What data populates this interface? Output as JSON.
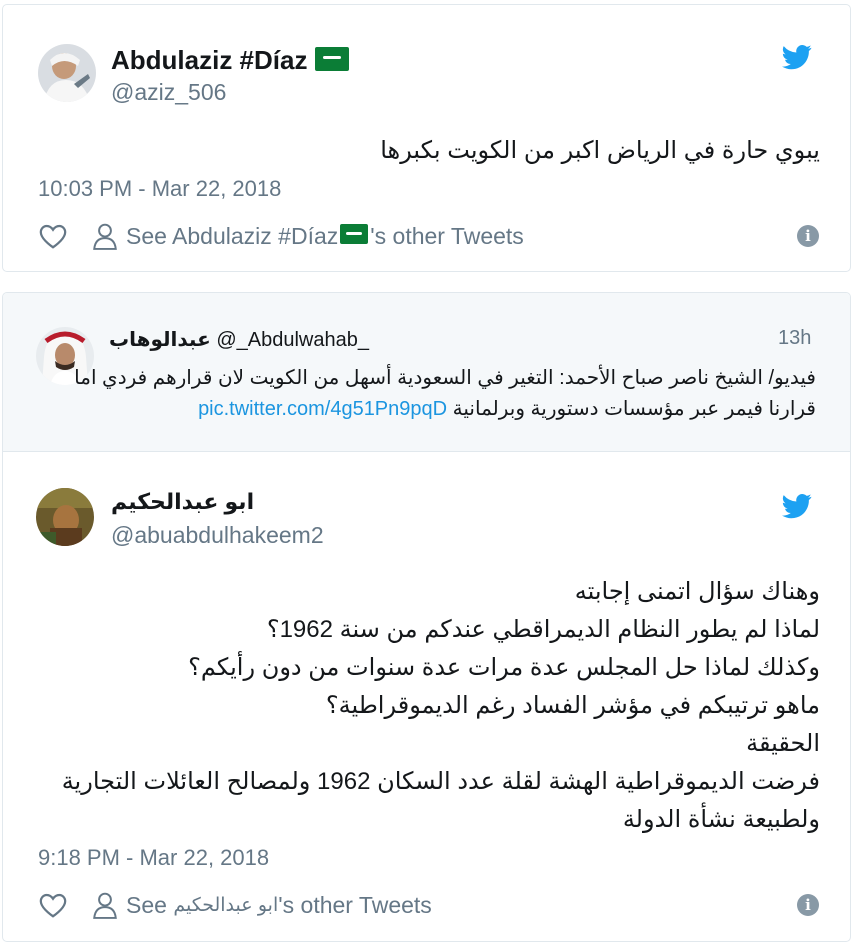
{
  "tweet1": {
    "display_name": "Abdulaziz #Díaz",
    "handle": "@aziz_506",
    "text": "يبوي حارة في الرياض اكبر من الكويت بكبرها",
    "timestamp": "10:03 PM - Mar 22, 2018",
    "see_prefix": "See Abdulaziz #Díaz",
    "see_suffix": "'s other Tweets",
    "info_label": "i"
  },
  "quoted": {
    "display_name": "عبدالوهاب",
    "handle": "@_Abdulwahab_",
    "time": "13h",
    "line1": "فيديو/ الشيخ ناصر صباح الأحمد: التغير في السعودية أسهل من الكويت لان قرارهم فردي اما",
    "line2_text": "قرارنا فيمر عبر مؤسسات دستورية وبرلمانية",
    "line2_link": "pic.twitter.com/4g51Pn9pqD"
  },
  "tweet2": {
    "display_name": "ابو عبدالحكيم",
    "handle": "@abuabdulhakeem2",
    "lines": [
      "وهناك سؤال اتمنى إجابته",
      "لماذا لم يطور النظام الديمراقطي عندكم من سنة 1962؟",
      "وكذلك لماذا حل المجلس عدة مرات عدة سنوات من دون رأيكم؟",
      "ماهو ترتيبكم في مؤشر الفساد رغم الديموقراطية؟",
      "الحقيقة",
      "فرضت الديموقراطية الهشة لقلة عدد السكان 1962 ولمصالح العائلات التجارية",
      "ولطبيعة نشأة الدولة"
    ],
    "timestamp": "9:18 PM - Mar 22, 2018",
    "see_prefix": "See",
    "see_name": "ابو عبدالحكيم",
    "see_suffix": "'s other Tweets",
    "info_label": "i"
  },
  "colors": {
    "twitter_blue": "#1da1f2",
    "link_blue": "#1b95e0",
    "secondary_text": "#657786",
    "border": "#e1e8ed",
    "quote_bg": "#f5f8fa",
    "flag_green": "#0b7d36"
  },
  "icons": [
    "twitter-bird-icon",
    "heart-icon",
    "person-icon",
    "info-icon",
    "saudi-flag-emoji"
  ]
}
